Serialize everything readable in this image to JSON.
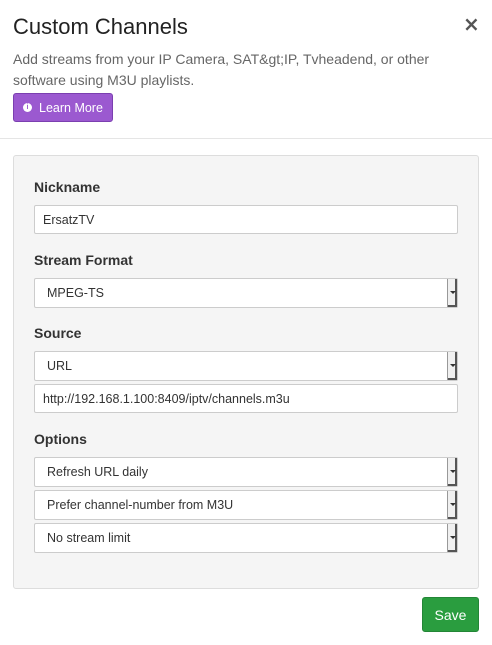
{
  "modal": {
    "title": "Custom Channels",
    "close_label": "×",
    "description": "Add streams from your IP Camera, SAT&gt;IP, Tvheadend, or other software using M3U playlists.",
    "learn_more_icon": "i",
    "learn_more_label": "Learn More"
  },
  "form": {
    "nickname": {
      "label": "Nickname",
      "value": "ErsatzTV"
    },
    "stream_format": {
      "label": "Stream Format",
      "selected": "MPEG-TS"
    },
    "source": {
      "label": "Source",
      "selected": "URL",
      "url_value": "http://192.168.1.100:8409/iptv/channels.m3u"
    },
    "options": {
      "label": "Options",
      "refresh": "Refresh URL daily",
      "channel_number": "Prefer channel-number from M3U",
      "stream_limit": "No stream limit"
    }
  },
  "footer": {
    "save_label": "Save"
  },
  "colors": {
    "learn_more_bg": "#9b59d0",
    "save_bg": "#2a9d3f",
    "panel_bg": "#f5f5f5"
  },
  "icons": {
    "close": "close-icon",
    "info": "info-icon",
    "select_arrow": "chevron-down-icon"
  }
}
